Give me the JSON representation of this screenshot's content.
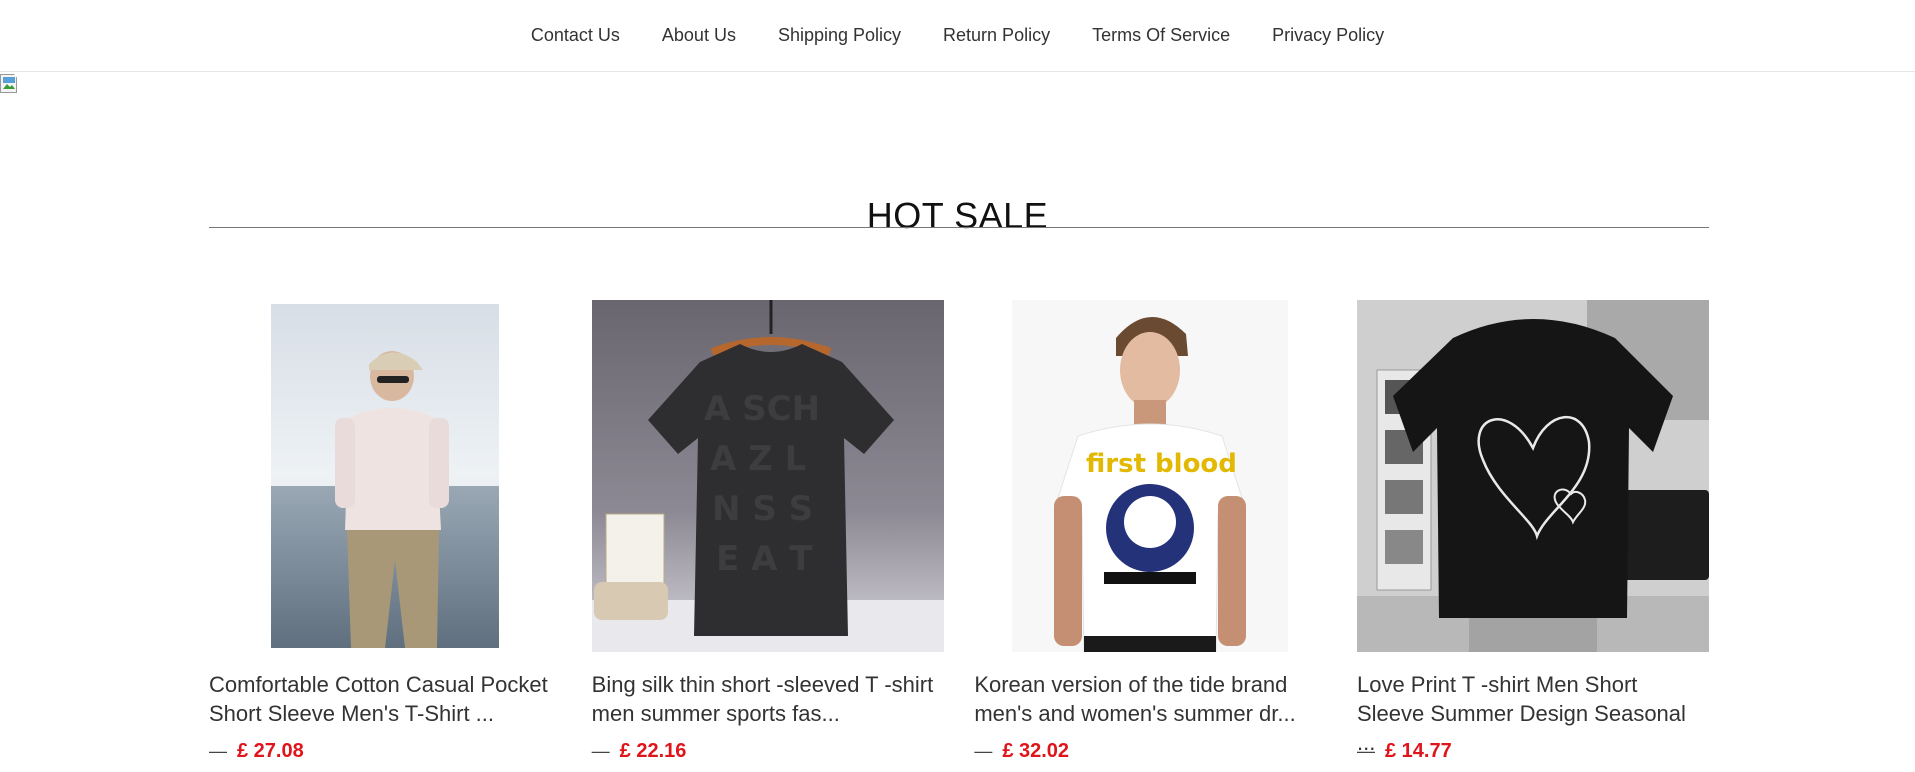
{
  "nav": {
    "items": [
      {
        "label": "Contact Us"
      },
      {
        "label": "About Us"
      },
      {
        "label": "Shipping Policy"
      },
      {
        "label": "Return Policy"
      },
      {
        "label": "Terms Of Service"
      },
      {
        "label": "Privacy Policy"
      }
    ]
  },
  "hot_sale": {
    "title": "HOT SALE",
    "products": [
      {
        "title": "Comfortable Cotton Casual Pocket Short Sleeve Men's T-Shirt ...",
        "dash": "—",
        "price": "£ 27.08",
        "image": "man-pink-tee-seaside"
      },
      {
        "title": "Bing silk thin short -sleeved T -shirt men summer sports fas...",
        "dash": "—",
        "price": "£ 22.16",
        "image": "black-letter-tee-on-hanger"
      },
      {
        "title": "Korean version of the tide brand men's and women's summer dr...",
        "dash": "—",
        "price": "£ 32.02",
        "image": "white-popeye-print-tee"
      },
      {
        "title": "Love Print T -shirt Men Short Sleeve Summer Design Seasonal ...",
        "dash": "—",
        "price": "£ 14.77",
        "image": "black-heart-print-oversized-tee"
      }
    ]
  },
  "colors": {
    "price": "#e0141b",
    "rule": "#777777",
    "nav_text": "#333333"
  }
}
